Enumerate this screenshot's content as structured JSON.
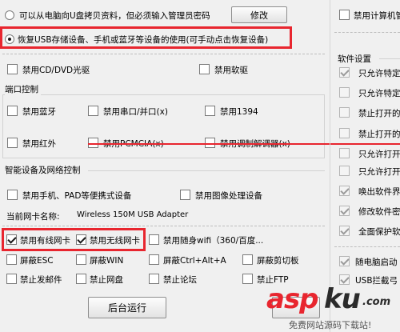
{
  "top": {
    "copy_option": "可以从电脑向U盘拷贝资料，但必须输入管理员密码",
    "modify_button": "修改",
    "restore_option": "恢复USB存储设备、手机或蓝牙等设备的使用(可手动点击恢复设备)",
    "disable_cd": "禁用CD/DVD光驱",
    "disable_floppy": "禁用软驱"
  },
  "ports": {
    "title": "端口控制",
    "items": [
      "禁用蓝牙",
      "禁用串口/并口(x)",
      "禁用1394",
      "禁用红外",
      "禁用PCMCIA(x)",
      "禁用调制解调器(x)"
    ]
  },
  "smart": {
    "title": "智能设备及网络控制",
    "disable_phone": "禁用手机、PAD等便携式设备",
    "disable_imaging": "禁用图像处理设备",
    "nic_label": "当前网卡名称:",
    "nic_name": "Wireless 150M USB Adapter",
    "row1": [
      "禁用有线网卡",
      "禁用无线网卡",
      "禁用随身wifi（360/百度..."
    ],
    "row2": [
      "屏蔽ESC",
      "屏蔽WIN",
      "屏蔽Ctrl+Alt+A",
      "屏蔽剪切板"
    ],
    "row3": [
      "禁止发邮件",
      "禁止网盘",
      "禁止论坛",
      "禁止FTP"
    ]
  },
  "run_button": "后台运行",
  "right": {
    "disable_computer_mgmt": "禁用计算机管",
    "software_settings_title": "软件设置",
    "items": [
      "只允许特定",
      "只允许特定",
      "禁止打开的",
      "禁止打开的",
      "只允许打开",
      "只允许打开",
      "唤出软件界",
      "修改软件密",
      "全面保护软",
      "随电脑启动",
      "USB拦截弓"
    ]
  },
  "watermark": {
    "brand": "asp",
    "brand2": "ku",
    "suffix": ".com",
    "caption": "免费网站源码下载站!"
  },
  "colors": {
    "highlight_red": "#e8262f",
    "watermark_red": "#e8262f",
    "watermark_dark": "#2b2b2b"
  }
}
